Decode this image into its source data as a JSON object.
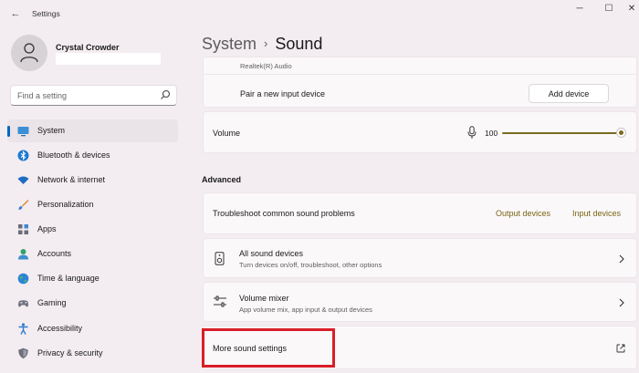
{
  "window": {
    "title": "Settings",
    "back_glyph": "←",
    "minimize_glyph": "─",
    "maximize_glyph": "☐",
    "close_glyph": "✕"
  },
  "user": {
    "name": "Crystal Crowder"
  },
  "search": {
    "placeholder": "Find a setting"
  },
  "sidebar": {
    "items": [
      {
        "label": "System",
        "icon": "monitor-icon",
        "active": true
      },
      {
        "label": "Bluetooth & devices",
        "icon": "bluetooth-icon"
      },
      {
        "label": "Network & internet",
        "icon": "wifi-icon"
      },
      {
        "label": "Personalization",
        "icon": "brush-icon"
      },
      {
        "label": "Apps",
        "icon": "apps-icon"
      },
      {
        "label": "Accounts",
        "icon": "person-icon"
      },
      {
        "label": "Time & language",
        "icon": "globe-icon"
      },
      {
        "label": "Gaming",
        "icon": "gamepad-icon"
      },
      {
        "label": "Accessibility",
        "icon": "accessibility-icon"
      },
      {
        "label": "Privacy & security",
        "icon": "shield-icon"
      }
    ]
  },
  "breadcrumb": {
    "parent": "System",
    "separator": "›",
    "current": "Sound"
  },
  "input_devices": {
    "device_sub": "Realtek(R) Audio",
    "pair_label": "Pair a new input device",
    "add_device_label": "Add device"
  },
  "volume": {
    "label": "Volume",
    "value": "100",
    "level": 1.0
  },
  "advanced": {
    "heading": "Advanced",
    "troubleshoot": {
      "label": "Troubleshoot common sound problems",
      "output_link": "Output devices",
      "input_link": "Input devices"
    },
    "all_devices": {
      "title": "All sound devices",
      "subtitle": "Turn devices on/off, troubleshoot, other options"
    },
    "volume_mixer": {
      "title": "Volume mixer",
      "subtitle": "App volume mix, app input & output devices"
    },
    "more_settings": {
      "label": "More sound settings"
    }
  },
  "colors": {
    "accent": "#0067c0",
    "link": "#7a6413",
    "slider": "#7a6a1f",
    "highlight": "#d81e28",
    "background": "#f3ecf0",
    "card": "#fbf8fa"
  }
}
